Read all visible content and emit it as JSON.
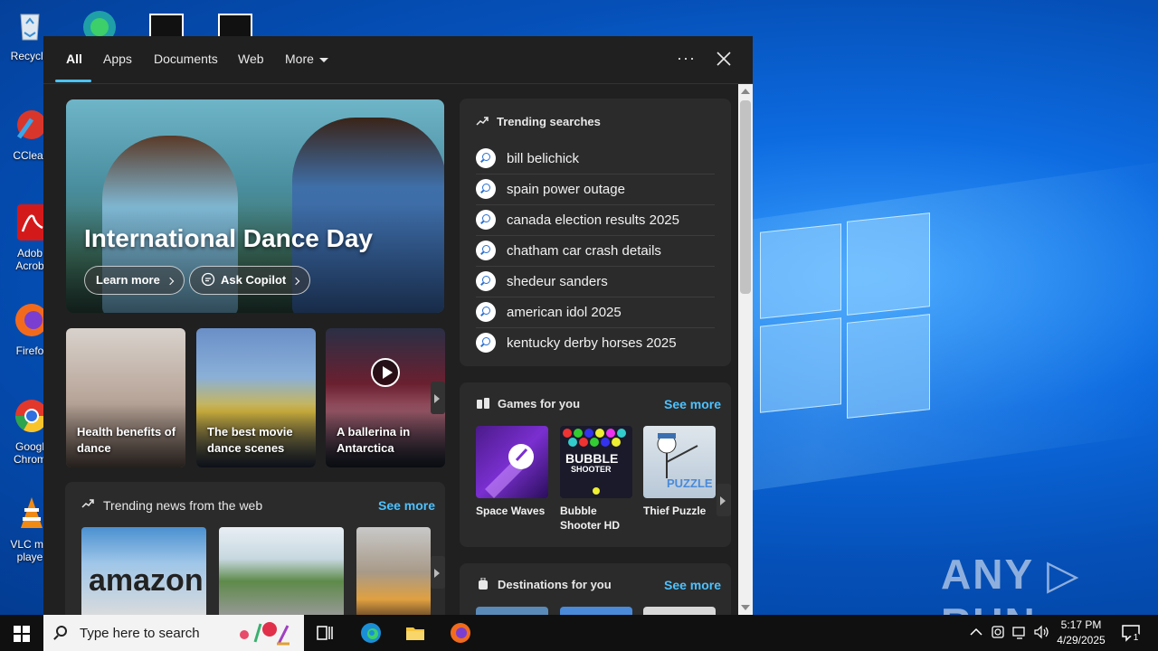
{
  "desktop": {
    "icons": [
      {
        "label": "Recycle"
      },
      {
        "label": "CClear"
      },
      {
        "label": "Adob\nAcrob"
      },
      {
        "label": "Firefo"
      },
      {
        "label": "Googl\nChrom"
      },
      {
        "label": "VLC me\nplaye"
      }
    ],
    "watermark": "ANY ▷ RUN"
  },
  "search_panel": {
    "tabs": [
      {
        "label": "All",
        "active": true
      },
      {
        "label": "Apps"
      },
      {
        "label": "Documents"
      },
      {
        "label": "Web"
      },
      {
        "label": "More"
      }
    ],
    "more_options_label": "···",
    "hero": {
      "title": "International Dance Day",
      "learn_more": "Learn more",
      "ask_copilot": "Ask Copilot"
    },
    "cards": [
      {
        "caption": "Health benefits of dance"
      },
      {
        "caption": "The best movie dance scenes"
      },
      {
        "caption": "A ballerina in Antarctica"
      }
    ],
    "trending_news": {
      "title": "Trending news from the web",
      "see_more": "See more",
      "thumb1_text": "amazon"
    },
    "trending_searches": {
      "title": "Trending searches",
      "items": [
        "bill belichick",
        "spain power outage",
        "canada election results 2025",
        "chatham car crash details",
        "shedeur sanders",
        "american idol 2025",
        "kentucky derby horses 2025"
      ]
    },
    "games": {
      "title": "Games for you",
      "see_more": "See more",
      "items": [
        {
          "name": "Space Waves"
        },
        {
          "name": "Bubble Shooter HD"
        },
        {
          "name": "Thief Puzzle"
        }
      ],
      "bubble_logo_1": "BUBBLE",
      "bubble_logo_2": "SHOOTER",
      "thief_logo": "PUZZLE"
    },
    "destinations": {
      "title": "Destinations for you",
      "see_more": "See more"
    }
  },
  "taskbar": {
    "search_placeholder": "Type here to search",
    "time": "5:17 PM",
    "date": "4/29/2025",
    "notification_count": "1"
  },
  "colors": {
    "accent": "#4cc2ff",
    "panel_bg": "#202020",
    "card_bg": "#2b2b2b"
  }
}
